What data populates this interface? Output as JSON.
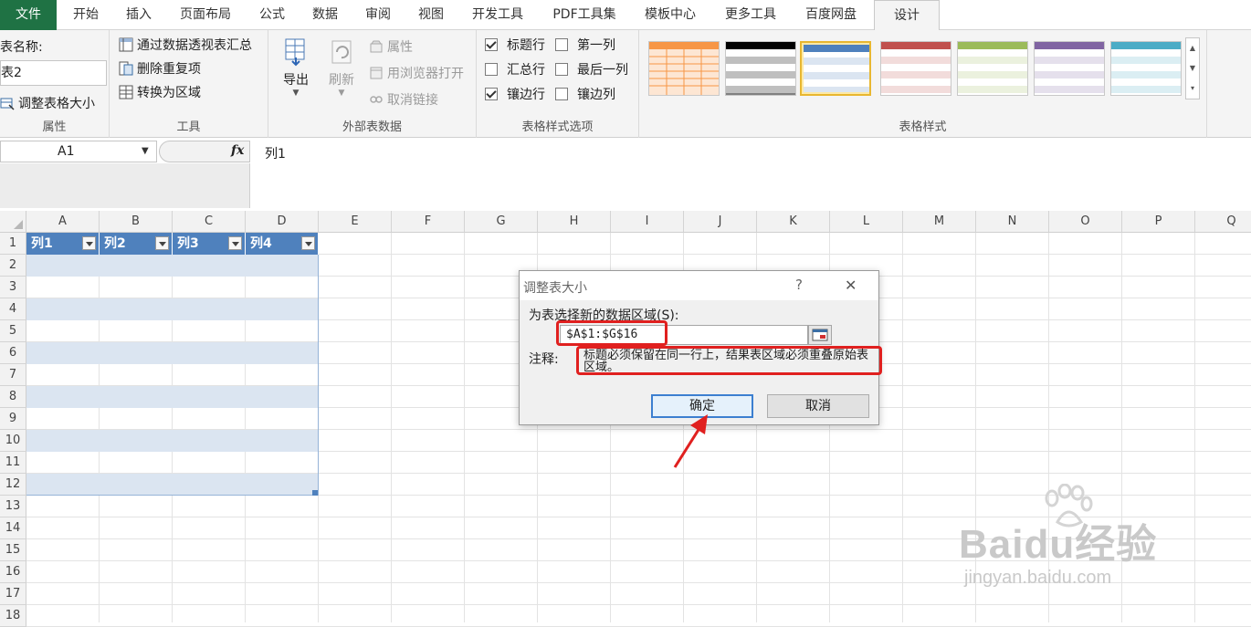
{
  "ribbon_tabs": [
    {
      "label": "文件"
    },
    {
      "label": "开始"
    },
    {
      "label": "插入"
    },
    {
      "label": "页面布局"
    },
    {
      "label": "公式"
    },
    {
      "label": "数据"
    },
    {
      "label": "审阅"
    },
    {
      "label": "视图"
    },
    {
      "label": "开发工具"
    },
    {
      "label": "PDF工具集"
    },
    {
      "label": "模板中心"
    },
    {
      "label": "更多工具"
    },
    {
      "label": "百度网盘"
    },
    {
      "label": "设计"
    }
  ],
  "properties_group": {
    "table_name_label": "表名称:",
    "table_name_value": "表2",
    "resize_table": "调整表格大小",
    "group_label": "属性"
  },
  "tools_group": {
    "pivot_summary": "通过数据透视表汇总",
    "remove_duplicates": "删除重复项",
    "convert_to_range": "转换为区域",
    "group_label": "工具"
  },
  "external_group": {
    "export": "导出",
    "refresh": "刷新",
    "properties": "属性",
    "open_in_browser": "用浏览器打开",
    "unlink": "取消链接",
    "group_label": "外部表数据"
  },
  "style_options_group": {
    "header_row": "标题行",
    "total_row": "汇总行",
    "banded_rows": "镶边行",
    "first_column": "第一列",
    "last_column": "最后一列",
    "banded_columns": "镶边列",
    "group_label": "表格样式选项"
  },
  "styles_group": {
    "group_label": "表格样式"
  },
  "name_box": {
    "value": "A1"
  },
  "fx_label": "fx",
  "formula_bar": {
    "value": "列1"
  },
  "columns": [
    "A",
    "B",
    "C",
    "D",
    "E",
    "F",
    "G",
    "H",
    "I",
    "J",
    "K",
    "L",
    "M",
    "N",
    "O",
    "P",
    "Q"
  ],
  "rows": [
    "1",
    "2",
    "3",
    "4",
    "5",
    "6",
    "7",
    "8",
    "9",
    "10",
    "11",
    "12",
    "13",
    "14",
    "15",
    "16",
    "17",
    "18"
  ],
  "table_headers": [
    "列1",
    "列2",
    "列3",
    "列4"
  ],
  "dialog": {
    "title": "调整表大小",
    "help": "?",
    "close": "✕",
    "prompt": "为表选择新的数据区域(S):",
    "range_value": "$A$1:$G$16",
    "note_label": "注释:",
    "note_text": "标题必须保留在同一行上，结果表区域必须重叠原始表区域。",
    "ok": "确定",
    "cancel": "取消"
  },
  "watermark": {
    "line1": "Baidu经验",
    "line2": "jingyan.baidu.com"
  },
  "colors": {
    "excel_green": "#1f7244",
    "table_header": "#4f81bd",
    "table_band": "#dbe5f1",
    "annotation_red": "#e0201f"
  }
}
